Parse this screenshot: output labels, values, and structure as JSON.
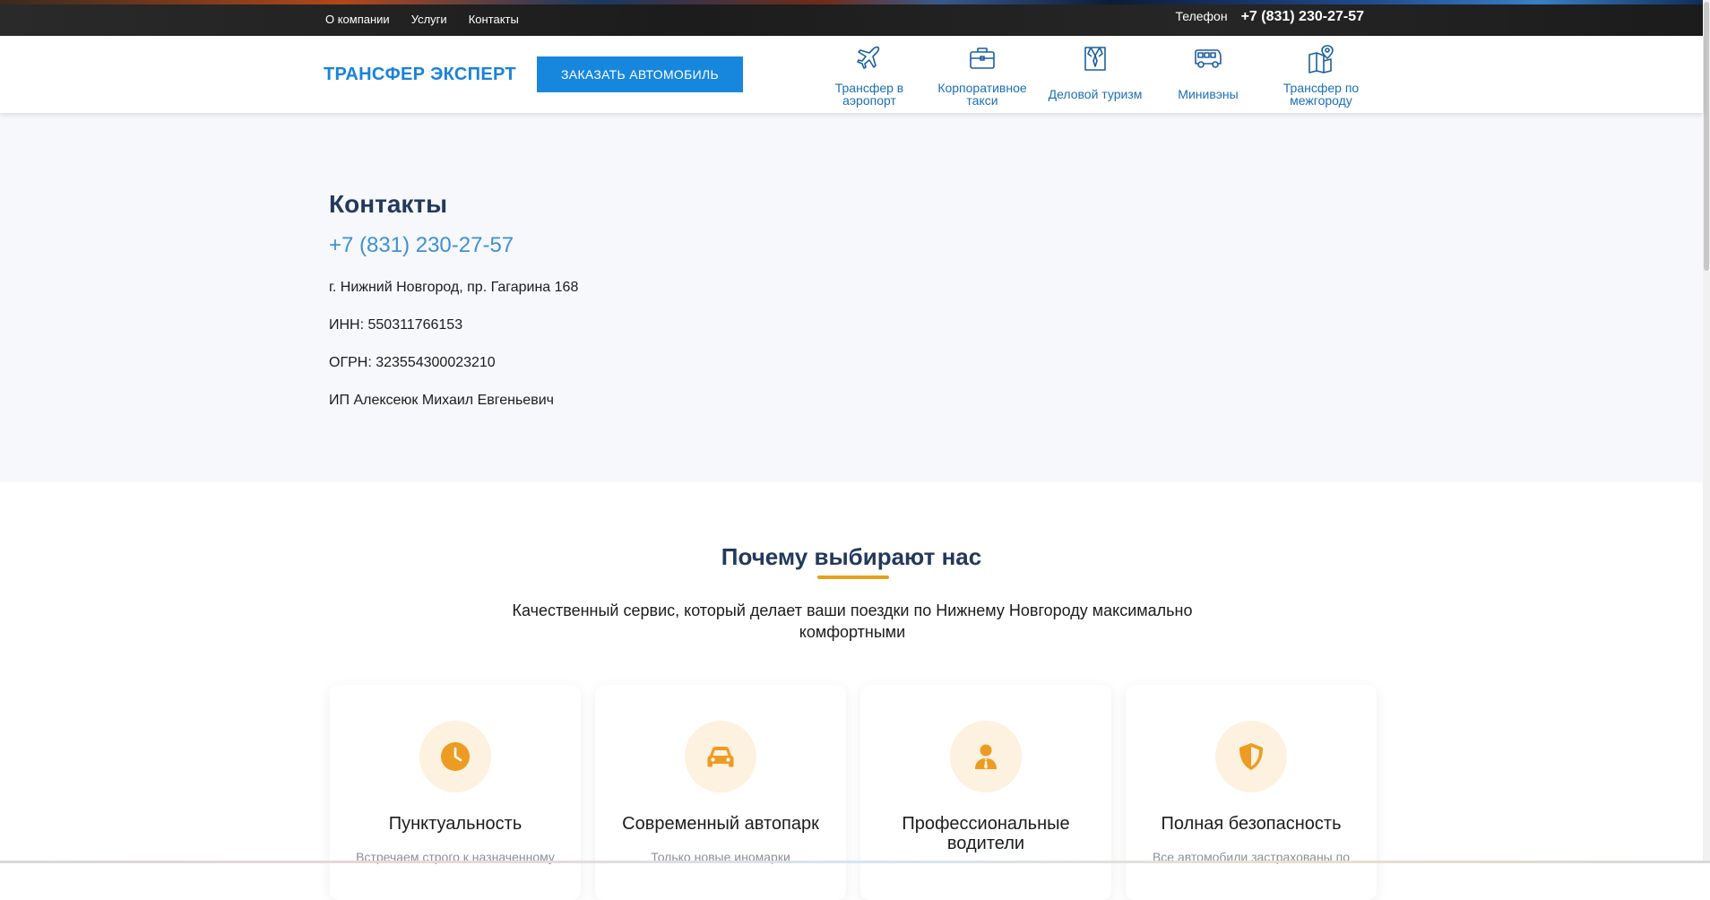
{
  "topbar": {
    "nav": [
      "О компании",
      "Услуги",
      "Контакты"
    ],
    "phone_label": "Телефон",
    "phone": "+7 (831) 230-27-57"
  },
  "header": {
    "logo": "ТРАНСФЕР ЭКСПЕРТ",
    "order_button": "ЗАКАЗАТЬ АВТОМОБИЛЬ",
    "services": [
      {
        "label": "Трансфер в аэропорт",
        "icon": "airplane-icon"
      },
      {
        "label": "Корпоративное такси",
        "icon": "briefcase-icon"
      },
      {
        "label": "Деловой туризм",
        "icon": "suit-icon"
      },
      {
        "label": "Минивэны",
        "icon": "minivan-icon"
      },
      {
        "label": "Трансфер по межгороду",
        "icon": "map-pin-icon"
      }
    ]
  },
  "contacts": {
    "title": "Контакты",
    "phone": "+7 (831) 230-27-57",
    "address": "г. Нижний Новгород, пр. Гагарина 168",
    "inn": "ИНН: 550311766153",
    "ogrn": "ОГРН: 323554300023210",
    "owner": "ИП Алексеюк Михаил Евгеньевич"
  },
  "why": {
    "title": "Почему выбирают нас",
    "subtitle": "Качественный сервис, который делает ваши поездки по Нижнему Новгороду максимально комфортными",
    "accent_color": "#e5a11c",
    "cards": [
      {
        "title": "Пунктуальность",
        "desc": "Встречаем строго к назначенному",
        "icon": "clock-icon"
      },
      {
        "title": "Современный автопарк",
        "desc": "Только новые иномарки",
        "icon": "car-icon"
      },
      {
        "title": "Профессиональные водители",
        "desc": "",
        "icon": "driver-icon"
      },
      {
        "title": "Полная безопасность",
        "desc": "Все автомобили застрахованы по",
        "icon": "shield-icon"
      }
    ]
  }
}
